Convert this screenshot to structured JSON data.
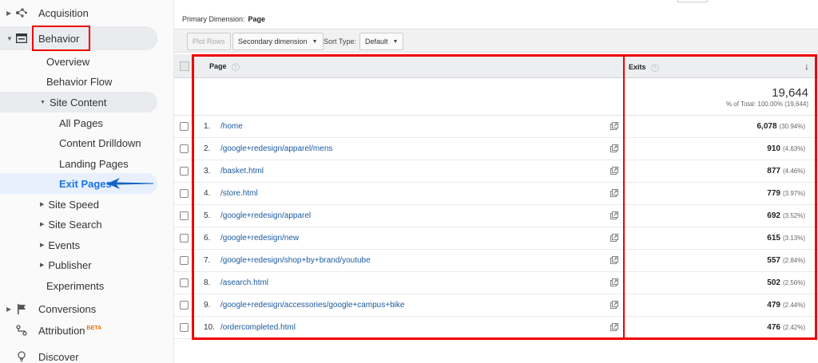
{
  "sidebar": {
    "acquisition": "Acquisition",
    "behavior": "Behavior",
    "overview": "Overview",
    "behavior_flow": "Behavior Flow",
    "site_content": "Site Content",
    "all_pages": "All Pages",
    "content_drilldown": "Content Drilldown",
    "landing_pages": "Landing Pages",
    "exit_pages": "Exit Pages",
    "site_speed": "Site Speed",
    "site_search": "Site Search",
    "events": "Events",
    "publisher": "Publisher",
    "experiments": "Experiments",
    "conversions": "Conversions",
    "attribution": "Attribution",
    "attribution_badge": "BETA",
    "discover": "Discover"
  },
  "header": {
    "primary_dimension_label": "Primary Dimension:",
    "primary_dimension_value": "Page"
  },
  "toolbar": {
    "plot_rows": "Plot Rows",
    "secondary_dimension": "Secondary dimension",
    "sort_type_label": "Sort Type:",
    "sort_type_value": "Default"
  },
  "table": {
    "col_page": "Page",
    "col_exits": "Exits",
    "help_glyph": "?",
    "total": {
      "value": "19,644",
      "percent": "% of Total: 100.00% (19,644)"
    },
    "rows": [
      {
        "index": "1.",
        "page": "/home",
        "exits": "6,078",
        "pct": "(30.94%)"
      },
      {
        "index": "2.",
        "page": "/google+redesign/apparel/mens",
        "exits": "910",
        "pct": "(4.63%)"
      },
      {
        "index": "3.",
        "page": "/basket.html",
        "exits": "877",
        "pct": "(4.46%)"
      },
      {
        "index": "4.",
        "page": "/store.html",
        "exits": "779",
        "pct": "(3.97%)"
      },
      {
        "index": "5.",
        "page": "/google+redesign/apparel",
        "exits": "692",
        "pct": "(3.52%)"
      },
      {
        "index": "6.",
        "page": "/google+redesign/new",
        "exits": "615",
        "pct": "(3.13%)"
      },
      {
        "index": "7.",
        "page": "/google+redesign/shop+by+brand/youtube",
        "exits": "557",
        "pct": "(2.84%)"
      },
      {
        "index": "8.",
        "page": "/asearch.html",
        "exits": "502",
        "pct": "(2.56%)"
      },
      {
        "index": "9.",
        "page": "/google+redesign/accessories/google+campus+bike",
        "exits": "479",
        "pct": "(2.44%)"
      },
      {
        "index": "10.",
        "page": "/ordercompleted.html",
        "exits": "476",
        "pct": "(2.42%)"
      }
    ]
  },
  "colors": {
    "highlight_red": "#e00000",
    "link_blue": "#1a5a9e",
    "active_blue": "#1a73e8"
  }
}
